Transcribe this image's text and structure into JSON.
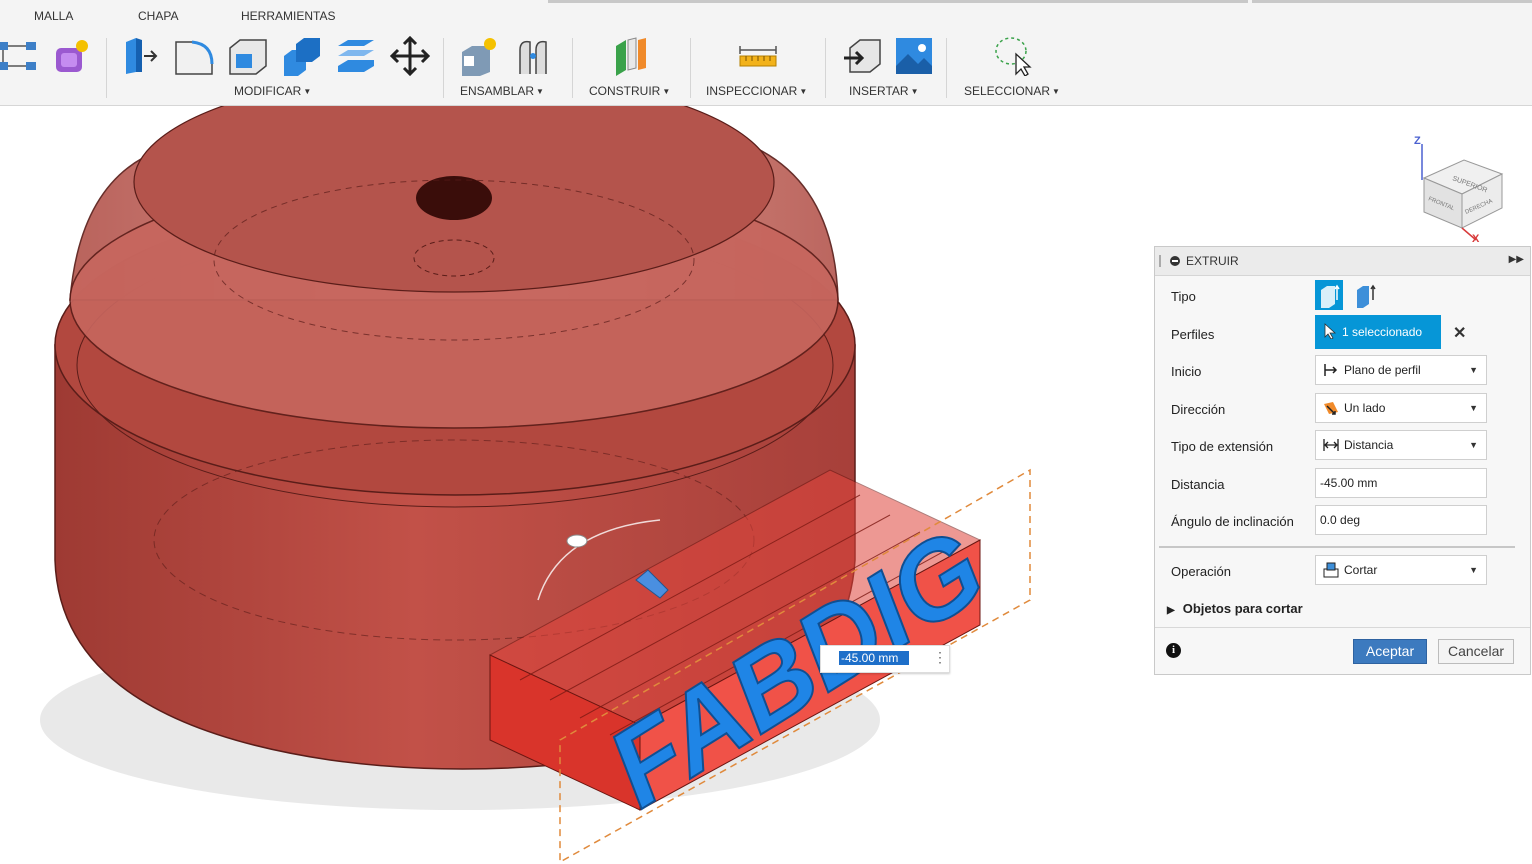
{
  "toolbar": {
    "workspace_tabs": [
      "MALLA",
      "CHAPA",
      "HERRAMIENTAS"
    ],
    "groups": {
      "modificar": "MODIFICAR",
      "ensamblar": "ENSAMBLAR",
      "construir": "CONSTRUIR",
      "inspeccionar": "INSPECCIONAR",
      "insertar": "INSERTAR",
      "seleccionar": "SELECCIONAR"
    },
    "icons": [
      "form-mesh-icon",
      "create-form-icon",
      "press-pull-icon",
      "fillet-icon",
      "shell-icon",
      "combine-icon",
      "offset-face-icon",
      "move-icon",
      "new-component-icon",
      "joint-icon",
      "construct-plane-icon",
      "measure-icon",
      "insert-derive-icon",
      "insert-image-icon",
      "select-window-icon"
    ]
  },
  "viewport": {
    "text_label": "FABDIG",
    "dimension_value": "-45.00 mm",
    "viewcube": {
      "axis_z": "Z",
      "axis_x": "X",
      "face_top": "SUPERIOR",
      "face_front": "FRONTAL",
      "face_right": "DERECHA"
    }
  },
  "dialog": {
    "title": "EXTRUIR",
    "rows": {
      "tipo": "Tipo",
      "perfiles": "Perfiles",
      "perfiles_value": "1 seleccionado",
      "inicio": "Inicio",
      "inicio_value": "Plano de perfil",
      "direccion": "Dirección",
      "direccion_value": "Un lado",
      "tipo_extension": "Tipo de extensión",
      "tipo_extension_value": "Distancia",
      "distancia": "Distancia",
      "distancia_value": "-45.00 mm",
      "angulo": "Ángulo de inclinación",
      "angulo_value": "0.0 deg",
      "operacion": "Operación",
      "operacion_value": "Cortar"
    },
    "objetos_para_cortar": "Objetos para cortar",
    "info": "i",
    "accept_label": "Aceptar",
    "cancel_label": "Cancelar"
  },
  "colors": {
    "accent": "#0696d7",
    "body_red": "#b8453d",
    "text_blue": "#1f85e6",
    "accept_button": "#3c7abf"
  }
}
